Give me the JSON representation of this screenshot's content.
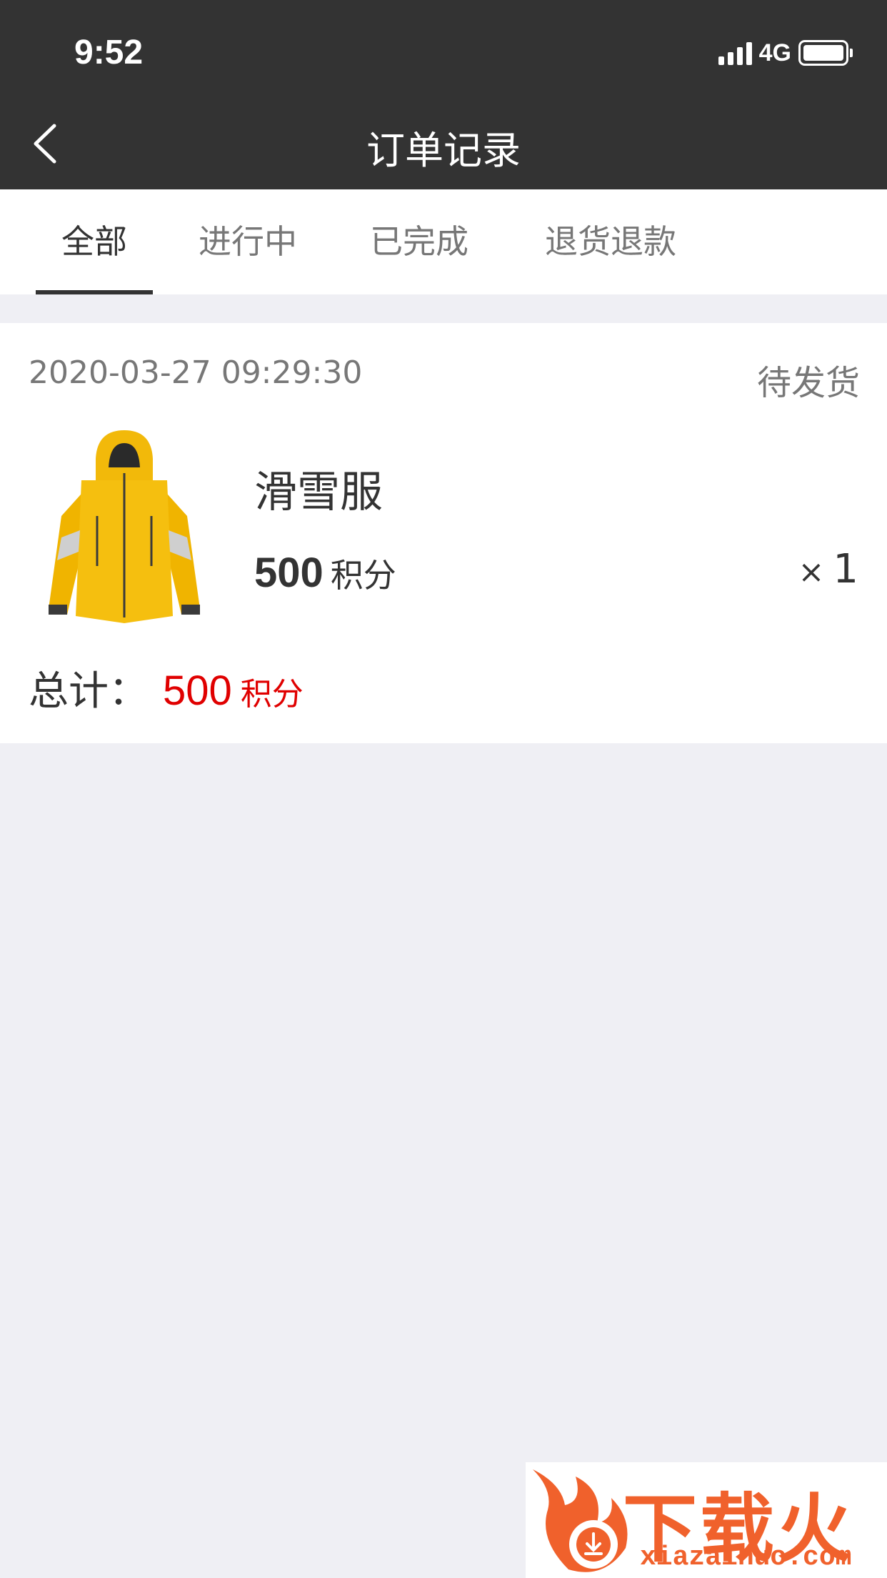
{
  "status_bar": {
    "time": "9:52",
    "network": "4G",
    "battery_level": 1.0
  },
  "nav": {
    "title": "订单记录"
  },
  "tabs": [
    {
      "label": "全部",
      "active": true
    },
    {
      "label": "进行中",
      "active": false
    },
    {
      "label": "已完成",
      "active": false
    },
    {
      "label": "退货退款",
      "active": false
    }
  ],
  "order": {
    "time": "2020-03-27 09:29:30",
    "status": "待发货",
    "product": {
      "name": "滑雪服",
      "price": "500",
      "price_unit": "积分",
      "qty_symbol": "×",
      "qty": "1"
    },
    "total_label": "总计：",
    "total": "500",
    "total_unit": "积分"
  },
  "watermark": {
    "title": "下载火",
    "url": "xiazaihuo.com"
  },
  "colors": {
    "header_bg": "#333333",
    "page_bg": "#efeff4",
    "accent_red": "#e00000",
    "watermark": "#f0612c"
  }
}
